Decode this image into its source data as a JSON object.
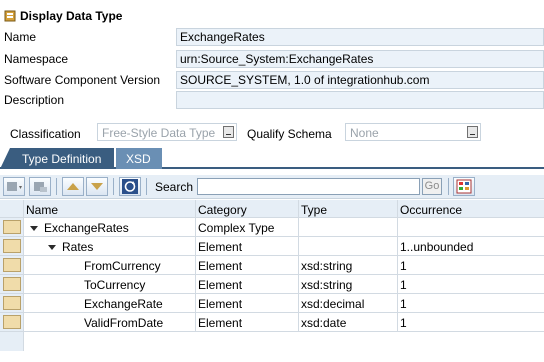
{
  "header": {
    "title": "Display Data Type"
  },
  "fields": [
    {
      "label": "Name",
      "value": "ExchangeRates"
    },
    {
      "label": "Namespace",
      "value": "urn:Source_System:ExchangeRates"
    },
    {
      "label": "Software Component Version",
      "value": "SOURCE_SYSTEM, 1.0 of integrationhub.com"
    },
    {
      "label": "Description",
      "value": ""
    }
  ],
  "classification": {
    "label": "Classification",
    "value": "Free-Style Data Type"
  },
  "qualify_schema": {
    "label": "Qualify Schema",
    "value": "None"
  },
  "tabs": [
    {
      "label": "Type Definition",
      "active": true
    },
    {
      "label": "XSD",
      "active": false
    }
  ],
  "toolbar": {
    "search_label": "Search",
    "search_value": "",
    "go_label": "Go"
  },
  "table": {
    "columns": [
      "Name",
      "Category",
      "Type",
      "Occurrence"
    ],
    "rows": [
      {
        "name": "ExchangeRates",
        "category": "Complex Type",
        "type": "",
        "occurrence": "",
        "expanded": true
      },
      {
        "name": "Rates",
        "category": "Element",
        "type": "",
        "occurrence": "1..unbounded",
        "expanded": true
      },
      {
        "name": "FromCurrency",
        "category": "Element",
        "type": "xsd:string",
        "occurrence": "1"
      },
      {
        "name": "ToCurrency",
        "category": "Element",
        "type": "xsd:string",
        "occurrence": "1"
      },
      {
        "name": "ExchangeRate",
        "category": "Element",
        "type": "xsd:decimal",
        "occurrence": "1"
      },
      {
        "name": "ValidFromDate",
        "category": "Element",
        "type": "xsd:date",
        "occurrence": "1"
      }
    ]
  }
}
